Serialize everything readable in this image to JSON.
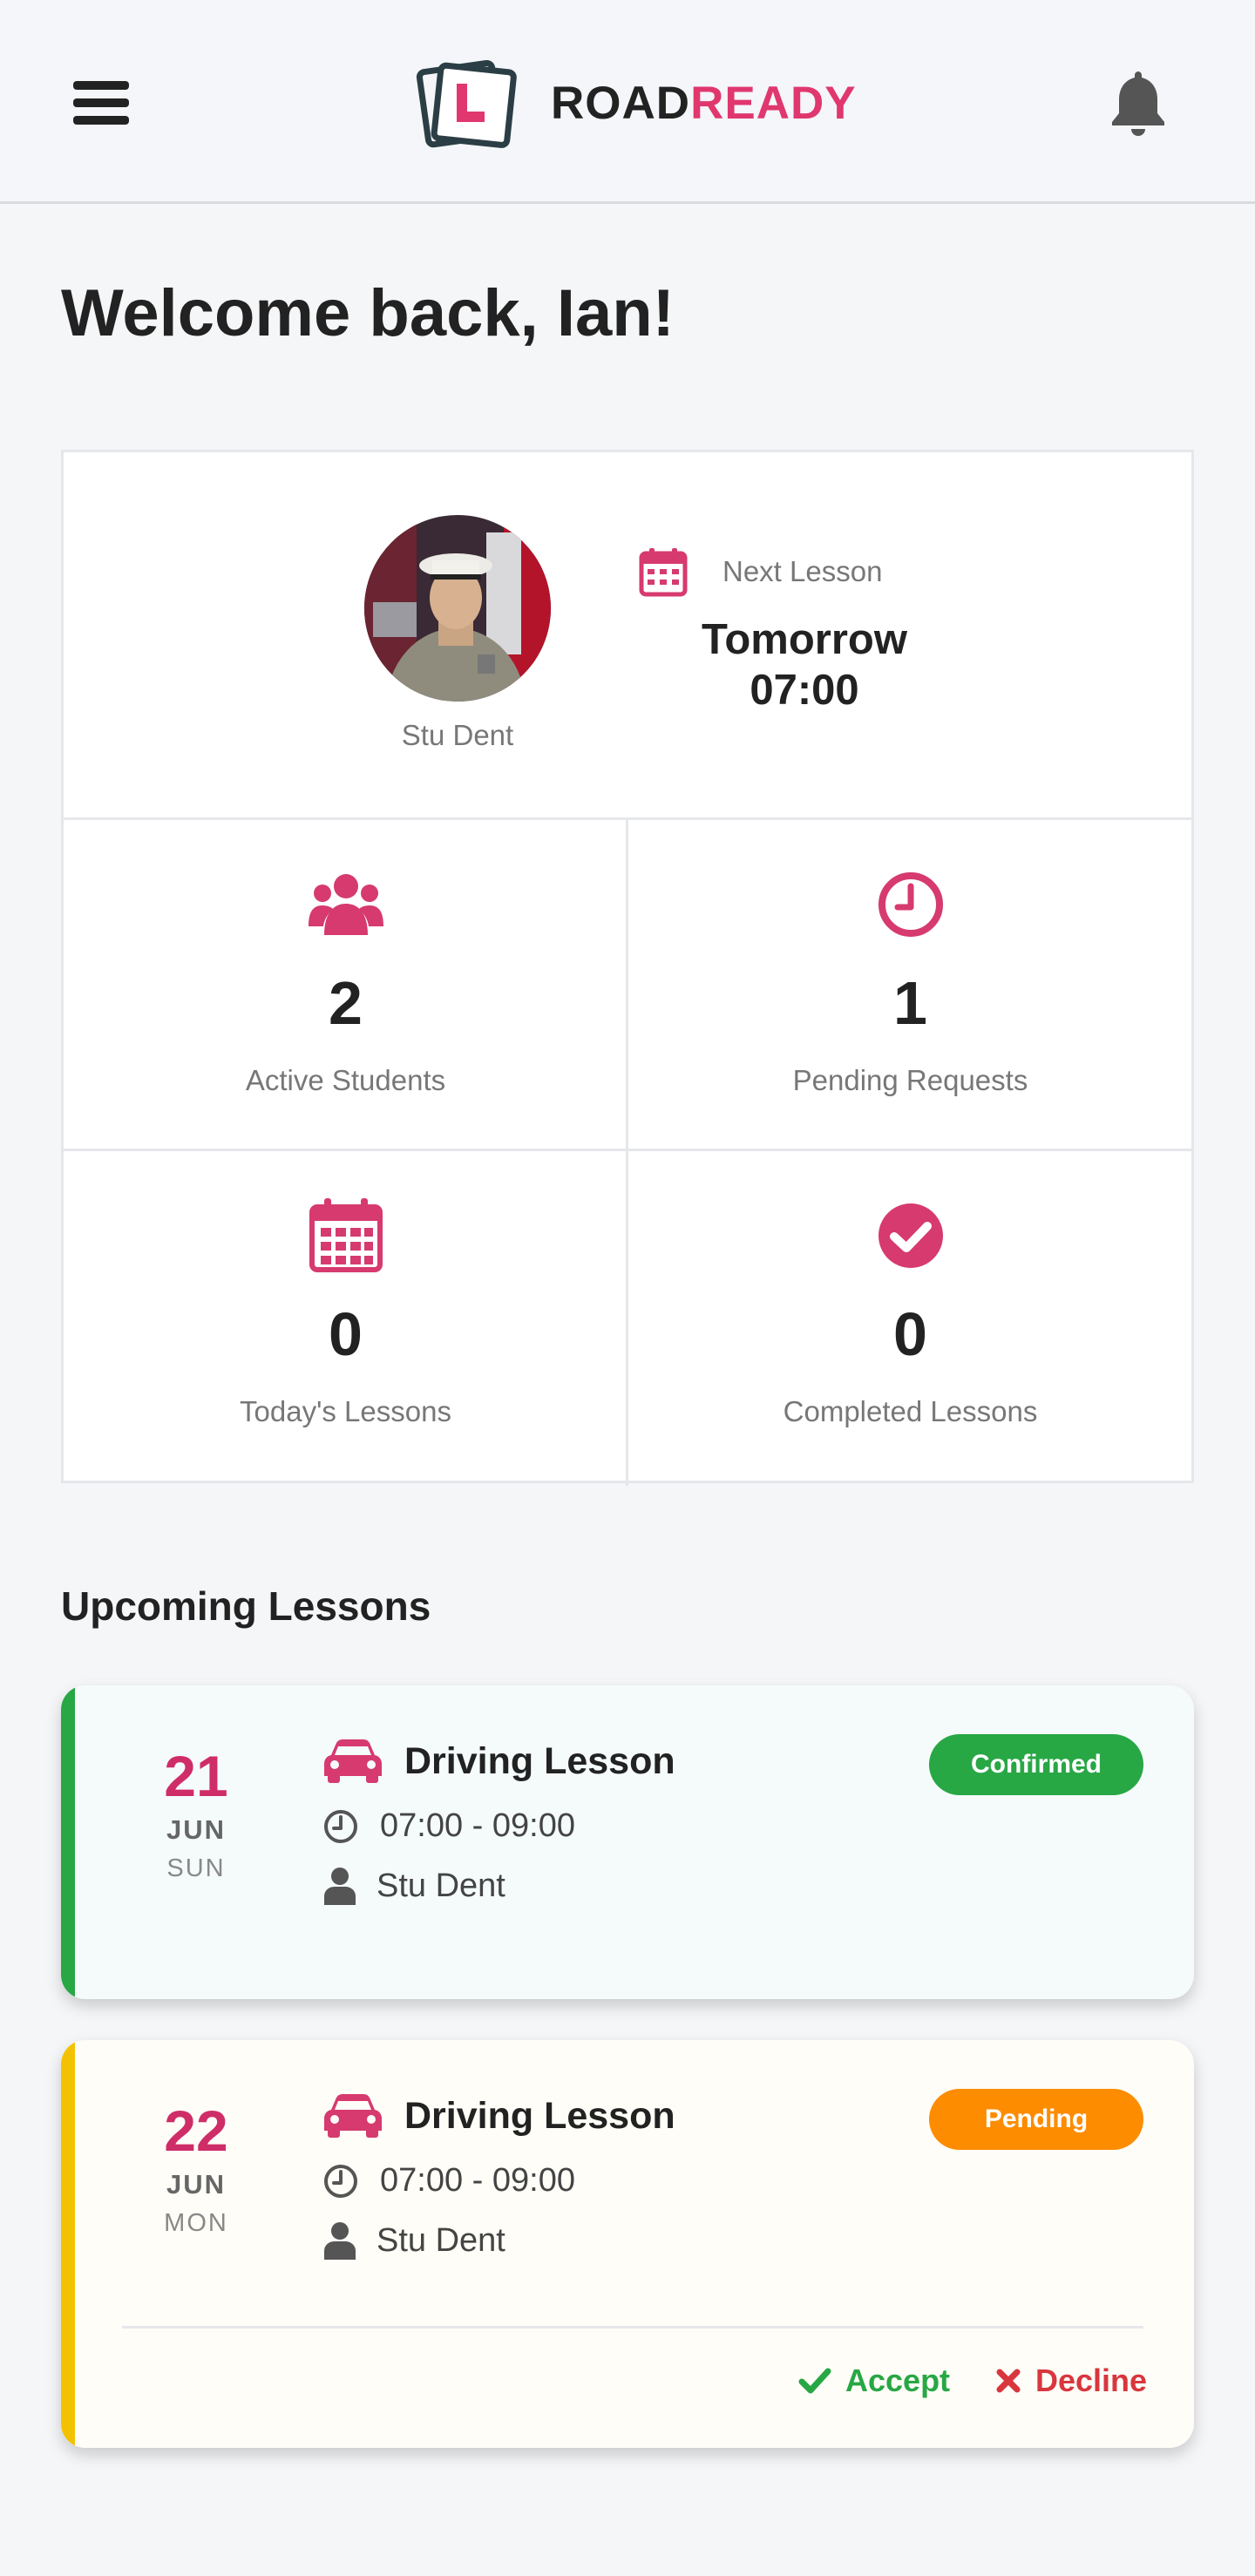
{
  "header": {
    "logo_part1": "ROAD",
    "logo_part2": "READY",
    "menu_icon": "hamburger-menu-icon",
    "bell_icon": "bell-icon",
    "brand_color": "#e0376e"
  },
  "welcome": "Welcome back, Ian!",
  "profile": {
    "student_name": "Stu Dent",
    "next_lesson_label": "Next Lesson",
    "next_lesson_day": "Tomorrow",
    "next_lesson_time": "07:00"
  },
  "stats": [
    {
      "value": "2",
      "label": "Active Students",
      "icon": "users-icon"
    },
    {
      "value": "1",
      "label": "Pending Requests",
      "icon": "clock-icon"
    },
    {
      "value": "0",
      "label": "Today's Lessons",
      "icon": "calendar-icon"
    },
    {
      "value": "0",
      "label": "Completed Lessons",
      "icon": "check-circle-icon"
    }
  ],
  "upcoming": {
    "title": "Upcoming Lessons",
    "lessons": [
      {
        "day": "21",
        "month": "JUN",
        "weekday": "SUN",
        "title": "Driving Lesson",
        "time": "07:00 - 09:00",
        "student": "Stu Dent",
        "status": "Confirmed",
        "status_color": "#28a745",
        "accent_color": "#28a745",
        "background": "#f5fbfb"
      },
      {
        "day": "22",
        "month": "JUN",
        "weekday": "MON",
        "title": "Driving Lesson",
        "time": "07:00 - 09:00",
        "student": "Stu Dent",
        "status": "Pending",
        "status_color": "#fd8c00",
        "accent_color": "#f2c200",
        "background": "#fefdf7",
        "accept_label": "Accept",
        "decline_label": "Decline"
      }
    ]
  }
}
